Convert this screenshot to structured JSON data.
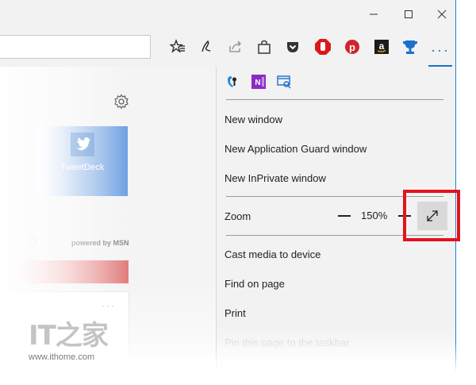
{
  "window": {
    "buttons": [
      "minimize",
      "maximize",
      "close"
    ]
  },
  "toolbar": {
    "icons": [
      "favorites-star-icon",
      "pen-note-icon",
      "share-icon",
      "shopping-bag-icon",
      "pocket-icon",
      "adblock-icon",
      "pinterest-icon",
      "amazon-icon",
      "trophy-extension-icon"
    ],
    "more_label": "···",
    "accent_color": "#1a73c9"
  },
  "page": {
    "tile_label": "TweetDeck",
    "powered_by": "powered by MSN",
    "card_more": "···"
  },
  "watermark": {
    "logo": "IT之家",
    "url": "www.ithome.com"
  },
  "menu": {
    "extensions": [
      "extension-icon",
      "onenote-icon",
      "web-clipper-icon"
    ],
    "items": [
      {
        "label": "New window"
      },
      {
        "label": "New Application Guard window"
      },
      {
        "label": "New InPrivate window"
      }
    ],
    "zoom": {
      "label": "Zoom",
      "minus": "—",
      "value": "150%",
      "plus": "+"
    },
    "items2": [
      {
        "label": "Cast media to device"
      },
      {
        "label": "Find on page"
      },
      {
        "label": "Print"
      },
      {
        "label": "Pin this page to the taskbar"
      }
    ]
  },
  "colors": {
    "highlight_border": "#e4121b",
    "window_border": "#1f80d6"
  }
}
